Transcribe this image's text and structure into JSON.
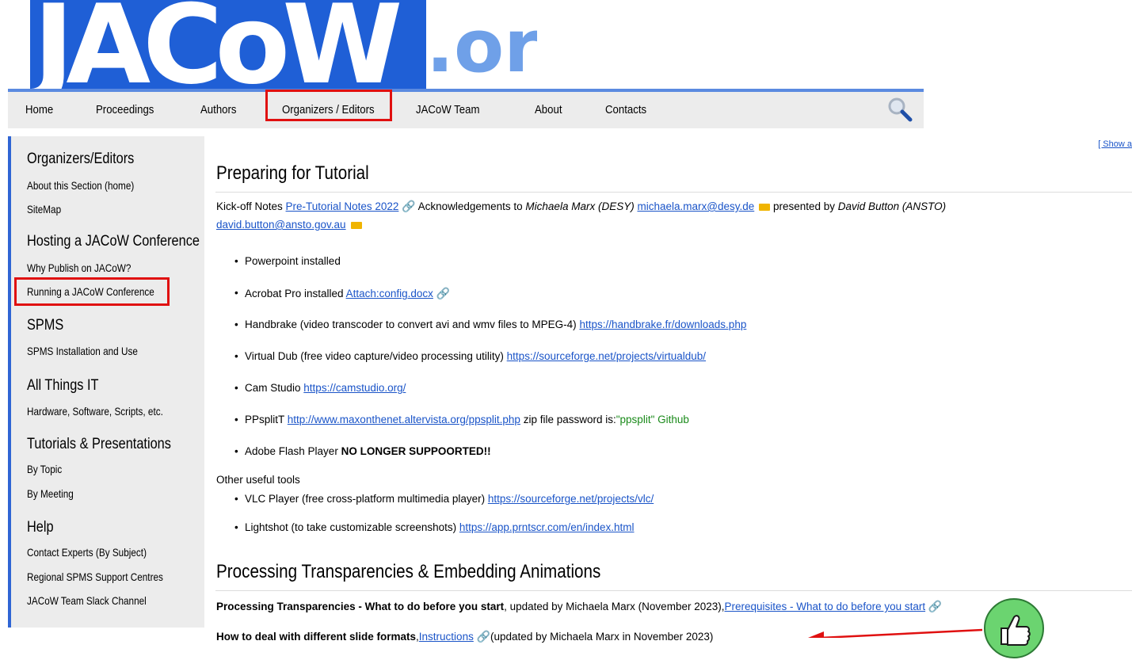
{
  "logo": {
    "main": "JACoW",
    "suffix": ".org"
  },
  "nav": {
    "items": [
      "Home",
      "Proceedings",
      "Authors",
      "Organizers / Editors",
      "JACoW Team",
      "About",
      "Contacts"
    ]
  },
  "sidebar": {
    "sections": [
      {
        "title": "Organizers/Editors",
        "links": [
          "About this Section (home)",
          "SiteMap"
        ]
      },
      {
        "title": "Hosting a JACoW Conference",
        "links": [
          "Why Publish on JACoW?",
          "Running a JACoW Conference"
        ]
      },
      {
        "title": "SPMS",
        "links": [
          "SPMS Installation and Use"
        ]
      },
      {
        "title": "All Things IT",
        "links": [
          "Hardware, Software, Scripts, etc."
        ]
      },
      {
        "title": "Tutorials & Presentations",
        "links": [
          "By Topic",
          "By Meeting"
        ]
      },
      {
        "title": "Help",
        "links": [
          "Contact Experts (By Subject)",
          "Regional SPMS Support Centres",
          "JACoW Team Slack Channel"
        ]
      }
    ]
  },
  "show_all": "[ Show a",
  "main": {
    "h1": "Preparing for Tutorial",
    "kickoff": {
      "prefix": "Kick-off Notes ",
      "link1": "Pre-Tutorial Notes 2022",
      "ack": " Acknowledgements to ",
      "ack_name": "Michaela Marx (DESY)",
      "email1": "michaela.marx@desy.de",
      "presented": " presented by ",
      "presenter": "David Button (ANSTO)",
      "email2": "david.button@ansto.gov.au"
    },
    "bullets": [
      {
        "text": "Powerpoint installed"
      },
      {
        "text": "Acrobat Pro installed ",
        "link": "Attach:config.docx"
      },
      {
        "text": "Handbrake (video transcoder to convert avi and wmv files to MPEG-4) ",
        "link": "https://handbrake.fr/downloads.php"
      },
      {
        "text": "Virtual Dub (free video capture/video processing utility) ",
        "link": "https://sourceforge.net/projects/virtualdub/"
      },
      {
        "text": "Cam Studio ",
        "link": "https://camstudio.org/"
      },
      {
        "text": "PPsplitT ",
        "link": "http://www.maxonthenet.altervista.org/ppsplit.php",
        "after": " zip file password is:",
        "pw": "\"ppsplit\" Github"
      },
      {
        "text": "Adobe Flash Player ",
        "bold": "NO LONGER SUPPOORTED!!"
      }
    ],
    "other_tools_label": "Other useful tools",
    "other_tools": [
      {
        "text": "VLC Player (free cross-platform multimedia player) ",
        "link": "https://sourceforge.net/projects/vlc/"
      },
      {
        "text": "Lightshot (to take customizable screenshots) ",
        "link": "https://app.prntscr.com/en/index.html"
      }
    ],
    "h2": "Processing Transparencies & Embedding Animations",
    "proc1": {
      "bold": "Processing Transparencies - What to do before you start",
      "text": ", updated by Michaela Marx (November 2023),",
      "link": "Prerequisites - What to do before you start"
    },
    "proc2": {
      "bold": "How to deal with different slide formats",
      "sep": ",",
      "link": "Instructions",
      "text": "(updated by Michaela Marx in November 2023)"
    }
  }
}
